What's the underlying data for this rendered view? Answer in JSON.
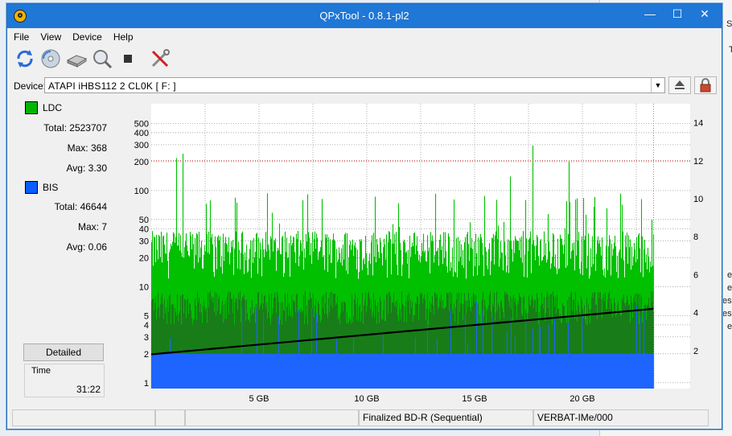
{
  "window": {
    "title": "QPxTool - 0.8.1-pl2",
    "minimize": "—",
    "maximize": "☐",
    "close": "✕"
  },
  "menu": [
    "File",
    "View",
    "Device",
    "Help"
  ],
  "device": {
    "label": "Device:",
    "value": "ATAPI   iHBS112   2     CL0K [ F: ]"
  },
  "legend": {
    "ldc": {
      "label": "LDC",
      "color": "#00b400",
      "total": "Total: 2523707",
      "max": "Max: 368",
      "avg": "Avg: 3.30"
    },
    "bis": {
      "label": "BIS",
      "color": "#0a5cff",
      "total": "Total: 46644",
      "max": "Max: 7",
      "avg": "Avg: 0.06"
    }
  },
  "detailed_label": "Detailed",
  "time": {
    "label": "Time",
    "value": "31:22"
  },
  "status": {
    "cell3": "Finalized BD-R (Sequential)",
    "cell4": "VERBAT-IMe/000"
  },
  "background_chars": [
    "S",
    "T",
    "e",
    "e",
    "es",
    "es",
    "e"
  ],
  "chart_data": {
    "type": "area",
    "x_tick_labels": [
      "5 GB",
      "10 GB",
      "15 GB",
      "20 GB"
    ],
    "x_ticks_gb": [
      5,
      10,
      15,
      20
    ],
    "x_range_gb": [
      0,
      25
    ],
    "data_end_gb": 23.3,
    "left_axis": {
      "scale": "log",
      "ticks": [
        1,
        2,
        3,
        4,
        5,
        10,
        20,
        30,
        40,
        50,
        100,
        200,
        300,
        400,
        500
      ],
      "range": [
        0.87,
        800
      ]
    },
    "right_axis": {
      "ticks": [
        2,
        4,
        6,
        8,
        10,
        12,
        14
      ],
      "range": [
        0,
        15
      ]
    },
    "series": [
      {
        "name": "LDC",
        "color": "#00c000",
        "typical": 20,
        "peak": 368
      },
      {
        "name": "BIS",
        "color": "#1e64ff",
        "typical": 2,
        "peak": 7
      },
      {
        "name": "speed",
        "color": "#000000",
        "start": 1.8,
        "end": 4.2
      }
    ],
    "ref_line_right": 12,
    "grid": true
  }
}
